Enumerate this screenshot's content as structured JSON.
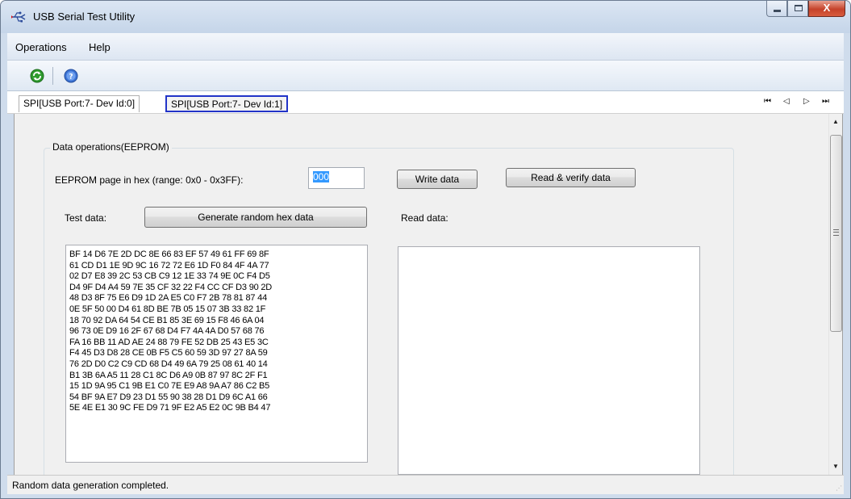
{
  "window": {
    "title": "USB Serial Test Utility",
    "controls": {
      "minimize": "–",
      "maximize": "□",
      "close": "X"
    }
  },
  "menu": {
    "items": [
      "Operations",
      "Help"
    ]
  },
  "toolbar": {
    "icons": [
      "refresh-icon",
      "help-icon"
    ]
  },
  "tabs": {
    "items": [
      {
        "label": "SPI[USB Port:7- Dev Id:0]"
      },
      {
        "label": "SPI[USB Port:7- Dev Id:1]"
      }
    ],
    "active_index": 1,
    "nav": {
      "first": "⏮",
      "prev": "◁",
      "next": "▷",
      "last": "⏭"
    }
  },
  "group": {
    "title": "Data operations(EEPROM)",
    "page_label": "EEPROM page in hex (range: 0x0 - 0x3FF):",
    "page_value": "000",
    "write_button": "Write data",
    "read_verify_button": "Read & verify data",
    "test_data_label": "Test data:",
    "generate_button": "Generate random hex data",
    "read_data_label": "Read data:",
    "test_data_lines": [
      "BF 14 D6 7E 2D DC 8E 66 83 EF 57 49 61 FF 69 8F",
      "61 CD D1 1E 9D 9C 16 72 72 E6 1D F0 84 4F 4A 77",
      "02 D7 E8 39 2C 53 CB C9 12 1E 33 74 9E 0C F4 D5",
      "D4 9F D4 A4 59 7E 35 CF 32 22 F4 CC CF D3 90 2D",
      "48 D3 8F 75 E6 D9 1D 2A E5 C0 F7 2B 78 81 87 44",
      "0E 5F 50 00 D4 61 8D BE 7B 05 15 07 3B 33 82 1F",
      "18 70 92 DA 64 54 CE B1 85 3E 69 15 F8 46 6A 04",
      "96 73 0E D9 16 2F 67 68 D4 F7 4A 4A D0 57 68 76",
      "FA 16 BB 11 AD AE 24 88 79 FE 52 DB 25 43 E5 3C",
      "F4 45 D3 D8 28 CE 0B F5 C5 60 59 3D 97 27 8A 59",
      "76 2D D0 C2 C9 CD 68 D4 49 6A 79 25 08 61 40 14",
      "B1 3B 6A A5 11 28 C1 8C D6 A9 0B 87 97 8C 2F F1",
      "15 1D 9A 95 C1 9B E1 C0 7E E9 A8 9A A7 86 C2 B5",
      "54 BF 9A E7 D9 23 D1 55 90 38 28 D1 D9 6C A1 66",
      "5E 4E E1 30 9C FE D9 71 9F E2 A5 E2 0C 9B B4 47"
    ],
    "read_data_value": ""
  },
  "status": {
    "text": "Random data generation completed."
  }
}
